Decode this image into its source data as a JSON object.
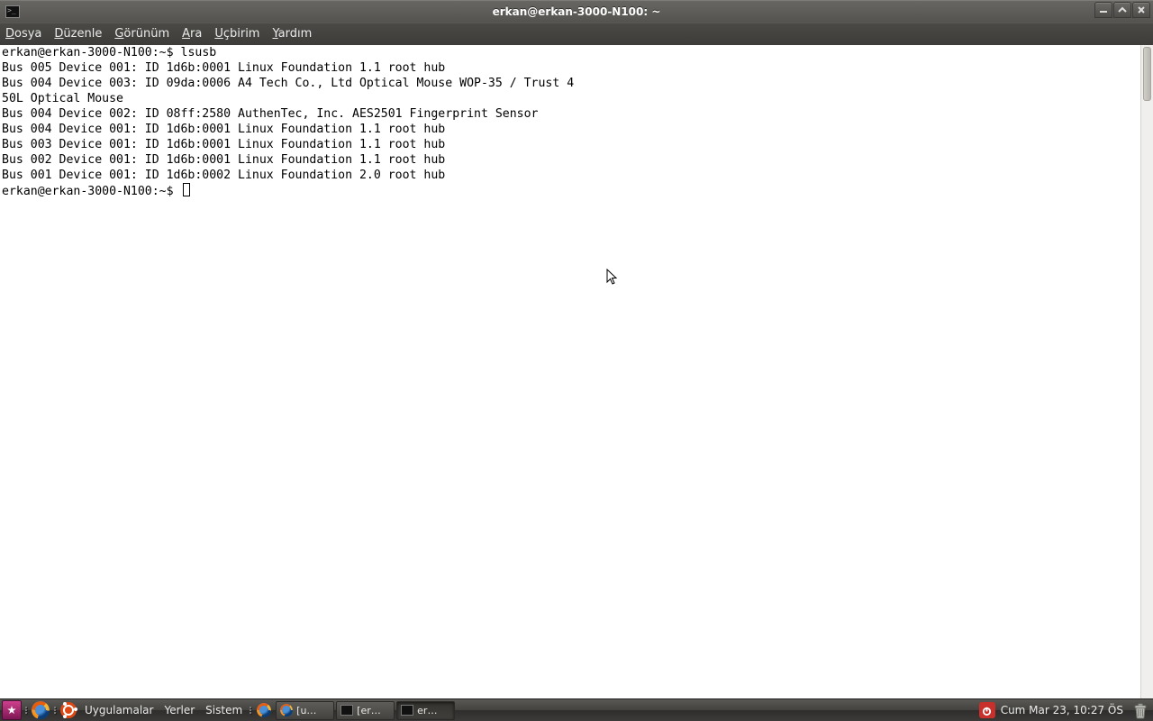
{
  "window": {
    "title": "erkan@erkan-3000-N100: ~"
  },
  "menubar": {
    "items": [
      {
        "ul": "D",
        "rest": "osya"
      },
      {
        "ul": "D",
        "rest": "üzenle"
      },
      {
        "ul": "G",
        "rest": "örünüm"
      },
      {
        "ul": "A",
        "rest": "ra"
      },
      {
        "ul": "U",
        "rest": "çbirim"
      },
      {
        "ul": "Y",
        "rest": "ardım"
      }
    ]
  },
  "terminal": {
    "prompt": "erkan@erkan-3000-N100:~$ ",
    "command": "lsusb",
    "output": [
      "Bus 005 Device 001: ID 1d6b:0001 Linux Foundation 1.1 root hub",
      "Bus 004 Device 003: ID 09da:0006 A4 Tech Co., Ltd Optical Mouse WOP-35 / Trust 4",
      "50L Optical Mouse",
      "Bus 004 Device 002: ID 08ff:2580 AuthenTec, Inc. AES2501 Fingerprint Sensor",
      "Bus 004 Device 001: ID 1d6b:0001 Linux Foundation 1.1 root hub",
      "Bus 003 Device 001: ID 1d6b:0001 Linux Foundation 1.1 root hub",
      "Bus 002 Device 001: ID 1d6b:0001 Linux Foundation 1.1 root hub",
      "Bus 001 Device 001: ID 1d6b:0002 Linux Foundation 2.0 root hub"
    ]
  },
  "panel": {
    "menus": [
      "Uygulamalar",
      "Yerler",
      "Sistem"
    ],
    "tasks": [
      {
        "label": "[u…",
        "active": false,
        "icon": "ff"
      },
      {
        "label": "[er…",
        "active": false,
        "icon": "term"
      },
      {
        "label": "er…",
        "active": true,
        "icon": "term"
      }
    ],
    "clock": "Cum Mar 23, 10:27 ÖS"
  }
}
